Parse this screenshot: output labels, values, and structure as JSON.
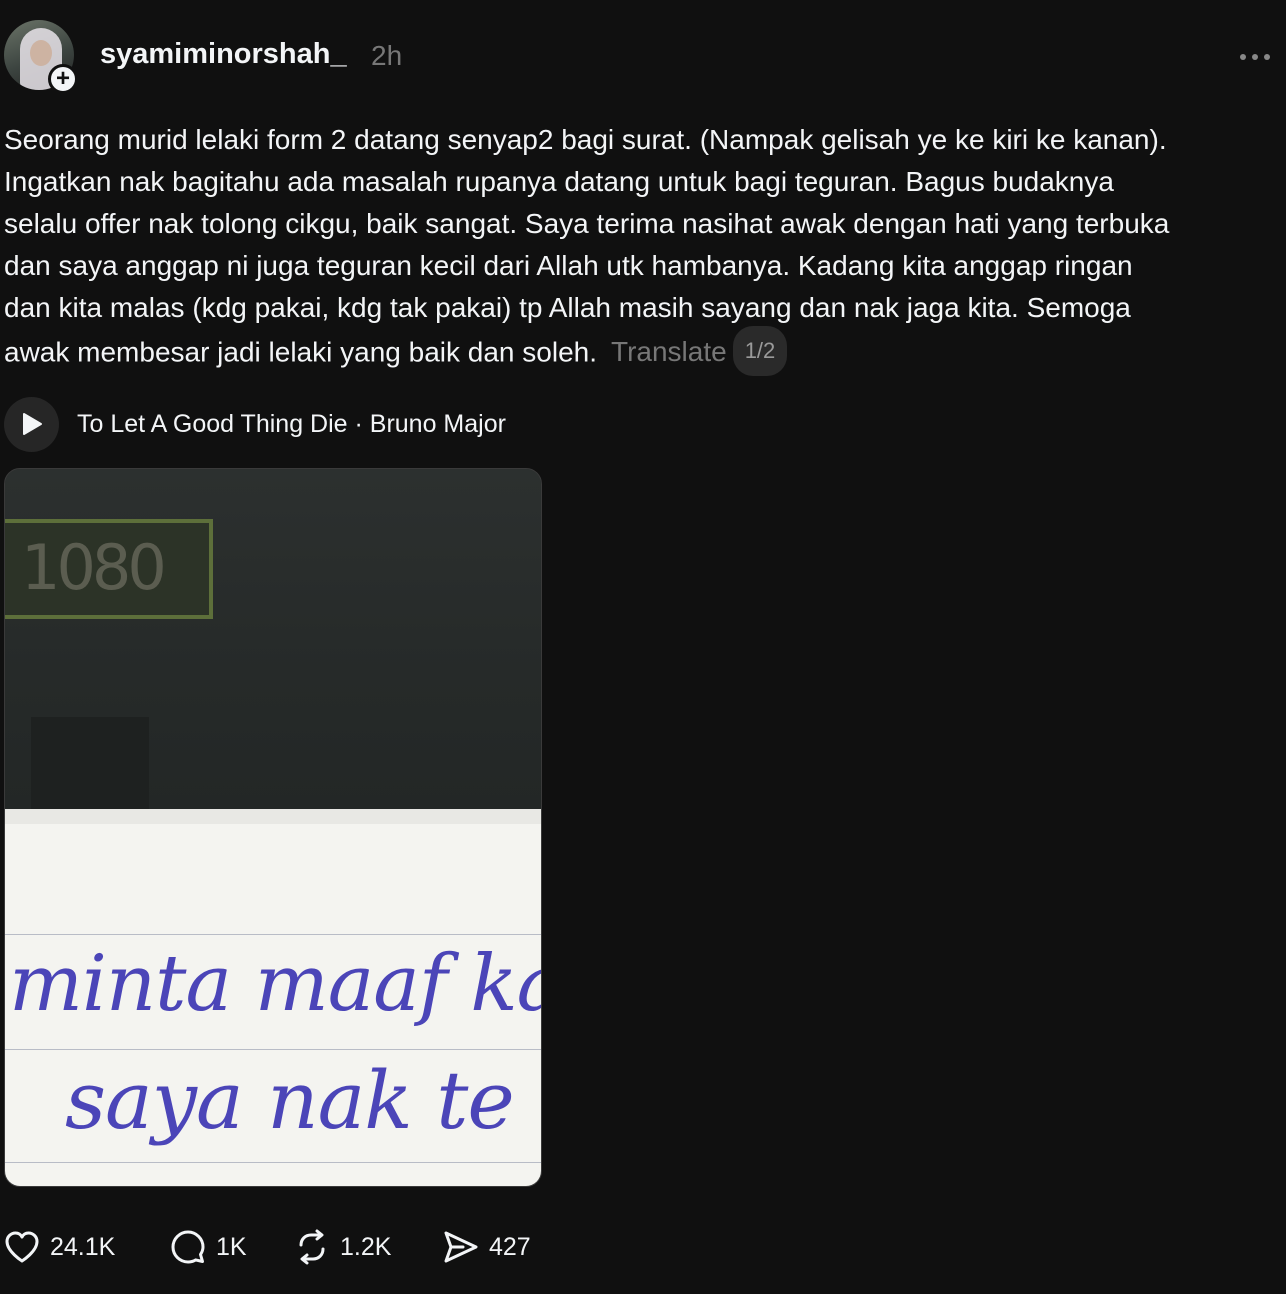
{
  "post": {
    "username": "syamiminorshah_",
    "timestamp": "2h",
    "text_lines": [
      "Seorang murid lelaki form 2 datang senyap2 bagi surat. (Nampak gelisah ye ke kiri ke kanan).",
      "Ingatkan nak bagitahu ada masalah rupanya datang untuk bagi teguran. Bagus budaknya",
      "selalu offer nak tolong cikgu, baik sangat. Saya terima nasihat awak dengan hati yang terbuka",
      "dan saya anggap ni juga teguran kecil dari Allah utk hambanya. Kadang kita anggap ringan",
      "dan kita malas (kdg pakai, kdg tak pakai) tp Allah masih sayang dan nak jaga kita. Semoga",
      "awak membesar jadi lelaki yang baik dan soleh."
    ],
    "translate_label": "Translate",
    "page_indicator": "1/2"
  },
  "music": {
    "label": "To Let A Good Thing Die · Bruno Major"
  },
  "media": {
    "sign_text": "1080",
    "handwriting_line1": "minta maaf kalau",
    "handwriting_line2": "saya nak te"
  },
  "actions": {
    "likes": "24.1K",
    "replies": "1K",
    "reposts": "1.2K",
    "shares": "427"
  },
  "colors": {
    "background": "#101010",
    "text": "#f3f5f7",
    "muted": "#777777",
    "ink": "#4b45b8"
  }
}
